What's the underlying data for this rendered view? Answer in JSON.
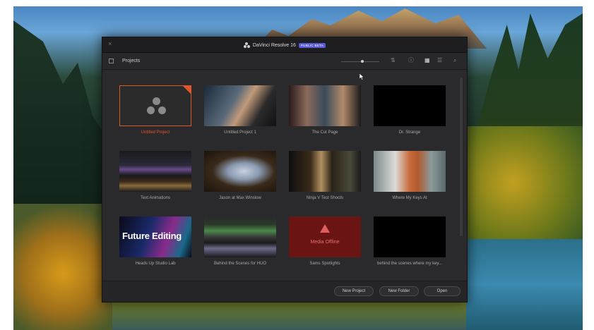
{
  "window": {
    "title": "DaVinci Resolve 16",
    "badge": "PUBLIC BETA",
    "close_glyph": "×"
  },
  "toolbar": {
    "breadcrumb": "Projects",
    "icons": [
      "panel-toggle-icon",
      "sort-icon",
      "info-icon",
      "grid-view-icon",
      "list-view-icon",
      "search-icon"
    ]
  },
  "projects": [
    {
      "name": "Untitled Project",
      "selected": true
    },
    {
      "name": "Untitled Project 1"
    },
    {
      "name": "The Cut Page"
    },
    {
      "name": "Dr. Strange"
    },
    {
      "name": "Text Animations"
    },
    {
      "name": "Jason at Max Winslow"
    },
    {
      "name": "Ninja V Test Shoots"
    },
    {
      "name": "Where My Keys At"
    },
    {
      "name": "Heads Up Studio Lab",
      "thumb_text": "Future Editing"
    },
    {
      "name": "Behind the Scenes for HUO"
    },
    {
      "name": "Sams Spotlights",
      "thumb_text": "Media Offline"
    },
    {
      "name": "behind the scenes where my key..."
    }
  ],
  "footer": {
    "new_project": "New Project",
    "new_folder": "New Folder",
    "open": "Open"
  },
  "colors": {
    "accent": "#e0562a",
    "badge": "#5a5ad8",
    "window_bg": "#2a2a2c"
  }
}
